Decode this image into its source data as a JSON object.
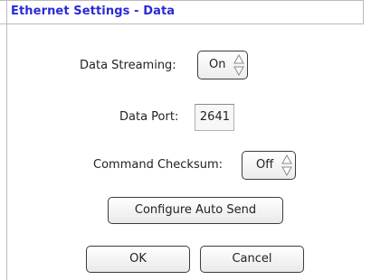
{
  "dialog": {
    "title": "Ethernet Settings - Data"
  },
  "data_streaming": {
    "label": "Data Streaming:",
    "value": "On"
  },
  "data_port": {
    "label": "Data Port:",
    "value": "2641"
  },
  "command_checksum": {
    "label": "Command Checksum:",
    "value": "Off"
  },
  "buttons": {
    "configure_auto_send": "Configure Auto Send",
    "ok": "OK",
    "cancel": "Cancel"
  },
  "icons": {
    "spin_arrows": "up-down-arrows-icon"
  }
}
